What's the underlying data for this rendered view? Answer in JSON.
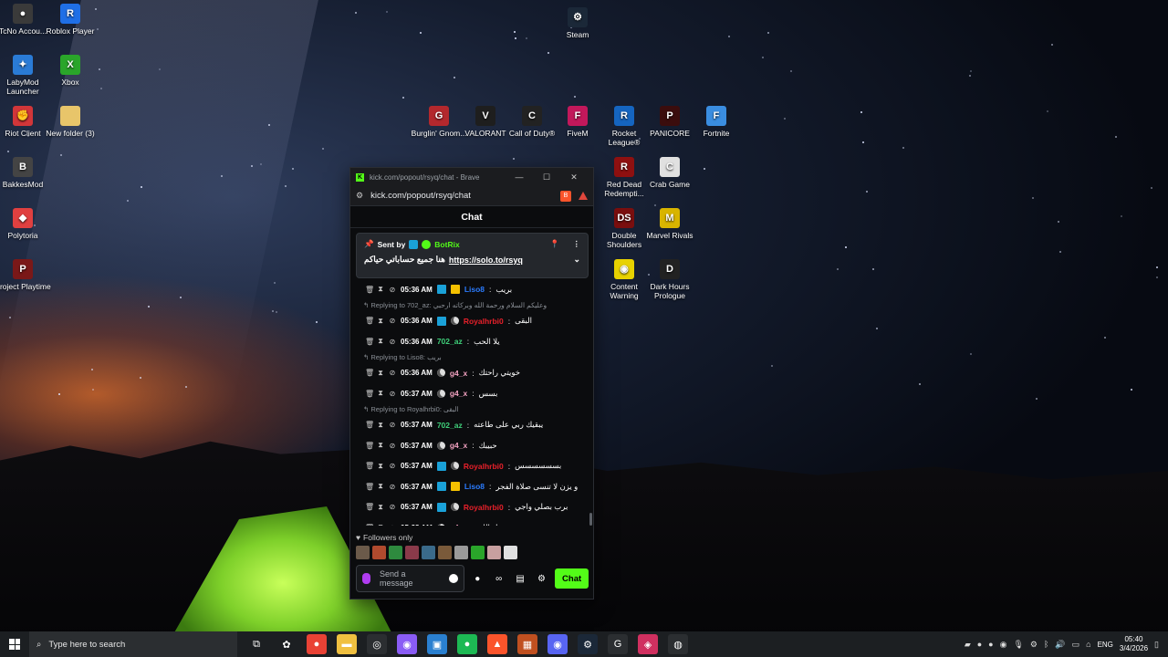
{
  "desktop": {
    "icons_left": [
      {
        "label": "TcNo Accou...",
        "glyph": "●",
        "color": "#3a3a3a"
      },
      {
        "label": "Roblox Player",
        "glyph": "R",
        "color": "#1f6fe6"
      },
      {
        "label": "LabyMod Launcher",
        "glyph": "✦",
        "color": "#2a7bd6"
      },
      {
        "label": "Xbox",
        "glyph": "X",
        "color": "#2aa52a"
      },
      {
        "label": "Riot Client",
        "glyph": "✊",
        "color": "#d13639"
      },
      {
        "label": "New folder (3)",
        "glyph": "",
        "color": "#e8c56a"
      },
      {
        "label": "BakkesMod",
        "glyph": "B",
        "color": "#444"
      },
      {
        "label": "Polytoria",
        "glyph": "◆",
        "color": "#e04040"
      },
      {
        "label": "Project Playtime",
        "glyph": "P",
        "color": "#7a1818"
      }
    ],
    "icons_right": [
      {
        "label": "Steam",
        "glyph": "⚙",
        "color": "#1b2838"
      },
      {
        "label": "Burglin' Gnom...",
        "glyph": "G",
        "color": "#b3282d"
      },
      {
        "label": "VALORANT",
        "glyph": "V",
        "color": "#1e1e1e"
      },
      {
        "label": "Call of Duty®",
        "glyph": "C",
        "color": "#222"
      },
      {
        "label": "FiveM",
        "glyph": "F",
        "color": "#c2185b"
      },
      {
        "label": "Rocket League®",
        "glyph": "R",
        "color": "#1565c0"
      },
      {
        "label": "PANICORE",
        "glyph": "P",
        "color": "#3b0d0d"
      },
      {
        "label": "Fortnite",
        "glyph": "F",
        "color": "#3a8de0"
      },
      {
        "label": "Red Dead Redempti...",
        "glyph": "R",
        "color": "#8e1010"
      },
      {
        "label": "Crab Game",
        "glyph": "C",
        "color": "#e0e0e0"
      },
      {
        "label": "Double Shoulders",
        "glyph": "DS",
        "color": "#7a0e0e"
      },
      {
        "label": "Marvel Rivals",
        "glyph": "M",
        "color": "#d8b400"
      },
      {
        "label": "Content Warning",
        "glyph": "◉",
        "color": "#e8d200"
      },
      {
        "label": "Dark Hours Prologue",
        "glyph": "D",
        "color": "#222"
      }
    ]
  },
  "browser": {
    "title": "kick.com/popout/rsyq/chat - Brave",
    "url": "kick.com/popout/rsyq/chat",
    "controls": {
      "minimize": "—",
      "maximize": "☐",
      "close": "✕"
    }
  },
  "chat": {
    "header": "Chat",
    "pinned": {
      "sent_by": "Sent by",
      "bot_name": "BotRix",
      "text": "هنا جميع حساباتي حياكم",
      "link": "https://solo.to/rsyq"
    },
    "messages": [
      {
        "kind": "msg",
        "time": "05:36 AM",
        "badges": [
          "b1",
          "b2"
        ],
        "user": "Liso8",
        "color": "#2b7cff",
        "text": "بريب"
      },
      {
        "kind": "reply",
        "text": "Replying to 702_az: وعليكم السلام ورحمة الله وبركاته ارحبي"
      },
      {
        "kind": "msg",
        "time": "05:36 AM",
        "badges": [
          "b1",
          "moon"
        ],
        "user": "Royalhrbi0",
        "color": "#e8202a",
        "text": "البقى"
      },
      {
        "kind": "msg",
        "time": "05:36 AM",
        "badges": [],
        "user": "702_az",
        "color": "#3fd07a",
        "text": "يلا الحب"
      },
      {
        "kind": "reply",
        "text": "Replying to Liso8: بريب"
      },
      {
        "kind": "msg",
        "time": "05:36 AM",
        "badges": [
          "moon"
        ],
        "user": "g4_x",
        "color": "#f2a2c0",
        "text": "خويتي راحتك"
      },
      {
        "kind": "msg",
        "time": "05:37 AM",
        "badges": [
          "moon"
        ],
        "user": "g4_x",
        "color": "#f2a2c0",
        "text": "بسس"
      },
      {
        "kind": "reply",
        "text": "Replying to Royalhrbi0: البقى"
      },
      {
        "kind": "msg",
        "time": "05:37 AM",
        "badges": [],
        "user": "702_az",
        "color": "#3fd07a",
        "text": "يبقيك ربي على طاعته"
      },
      {
        "kind": "msg",
        "time": "05:37 AM",
        "badges": [
          "moon"
        ],
        "user": "g4_x",
        "color": "#f2a2c0",
        "text": "حبيبك"
      },
      {
        "kind": "msg",
        "time": "05:37 AM",
        "badges": [
          "b1",
          "moon"
        ],
        "user": "Royalhrbi0",
        "color": "#e8202a",
        "text": "بسسسسسس"
      },
      {
        "kind": "msg",
        "time": "05:37 AM",
        "badges": [
          "b1",
          "b2"
        ],
        "user": "Liso8",
        "color": "#2b7cff",
        "text": "و يزن لا تنسى صلاة الفجر"
      },
      {
        "kind": "msg",
        "time": "05:37 AM",
        "badges": [
          "b1",
          "moon"
        ],
        "user": "Royalhrbi0",
        "color": "#e8202a",
        "text": "برب بصلي واجي"
      },
      {
        "kind": "msg",
        "time": "05:38 AM",
        "badges": [
          "moon"
        ],
        "user": "g4_x",
        "color": "#f2a2c0",
        "text": "تقبل الله"
      }
    ],
    "followers_only": "Followers only",
    "emote_colors": [
      "#6b5a4a",
      "#b04a2e",
      "#2e8a3e",
      "#8a3a4a",
      "#3a6a8a",
      "#7a5a3a",
      "#9a9a9a",
      "#2aa52a",
      "#c8a0a0",
      "#e0e0e0"
    ],
    "input_placeholder": "Send a message",
    "send_label": "Chat"
  },
  "taskbar": {
    "search_placeholder": "Type here to search",
    "apps": [
      {
        "name": "task-view",
        "glyph": "⧉",
        "color": "#1c1f22"
      },
      {
        "name": "steelseries",
        "glyph": "✿",
        "color": "#1c1f22"
      },
      {
        "name": "chrome",
        "glyph": "●",
        "color": "#e94235"
      },
      {
        "name": "file-explorer",
        "glyph": "▬",
        "color": "#f0c040"
      },
      {
        "name": "app-circle",
        "glyph": "◎",
        "color": "#2b2e31"
      },
      {
        "name": "discord-alt",
        "glyph": "◉",
        "color": "#8a5cf5"
      },
      {
        "name": "app-window",
        "glyph": "▣",
        "color": "#2a80d0"
      },
      {
        "name": "spotify",
        "glyph": "●",
        "color": "#1db954"
      },
      {
        "name": "brave",
        "glyph": "▲",
        "color": "#fb542b"
      },
      {
        "name": "app-grid",
        "glyph": "▦",
        "color": "#c05020"
      },
      {
        "name": "discord",
        "glyph": "◉",
        "color": "#5865f2"
      },
      {
        "name": "steam",
        "glyph": "⚙",
        "color": "#1b2838"
      },
      {
        "name": "app-g",
        "glyph": "G",
        "color": "#2b2e31"
      },
      {
        "name": "app-active",
        "glyph": "◈",
        "color": "#d03060"
      },
      {
        "name": "app-speed",
        "glyph": "◍",
        "color": "#2b2e31"
      }
    ],
    "language": "ENG",
    "time": "05:40",
    "date": "3/4/2026"
  }
}
